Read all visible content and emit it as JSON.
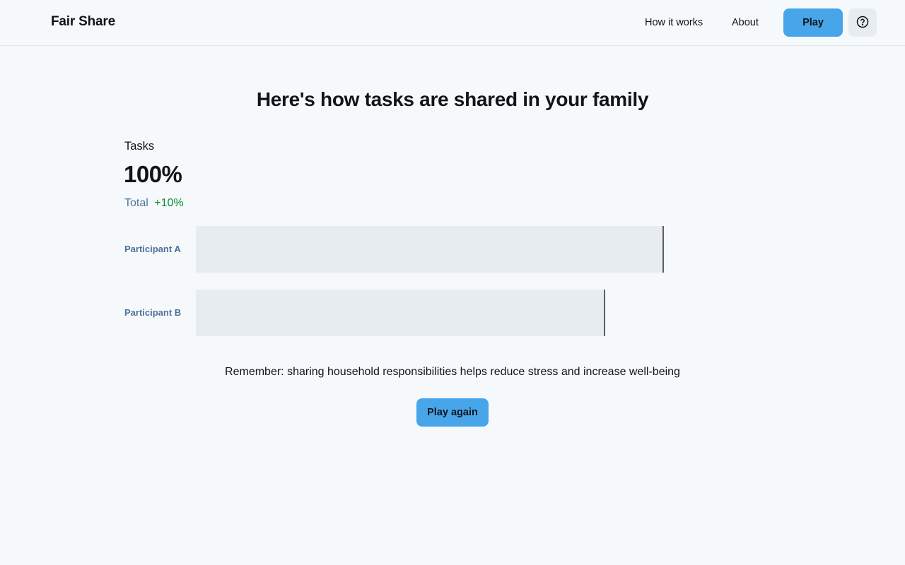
{
  "header": {
    "brand": "Fair Share",
    "nav": {
      "how_it_works": "How it works",
      "about": "About"
    },
    "play_label": "Play",
    "help_icon": "question-circle-icon"
  },
  "main": {
    "title": "Here's how tasks are shared in your family",
    "stat": {
      "label": "Tasks",
      "value": "100%",
      "sub_label": "Total",
      "delta": "+10%"
    },
    "participants": [
      {
        "label": "Participant A"
      },
      {
        "label": "Participant B"
      }
    ],
    "reminder": "Remember: sharing household responsibilities helps reduce stress and increase well-being",
    "play_again_label": "Play again"
  },
  "colors": {
    "accent": "#47a5ea",
    "positive": "#078a2e",
    "muted": "#4e7397",
    "background": "#f6f9fc"
  }
}
